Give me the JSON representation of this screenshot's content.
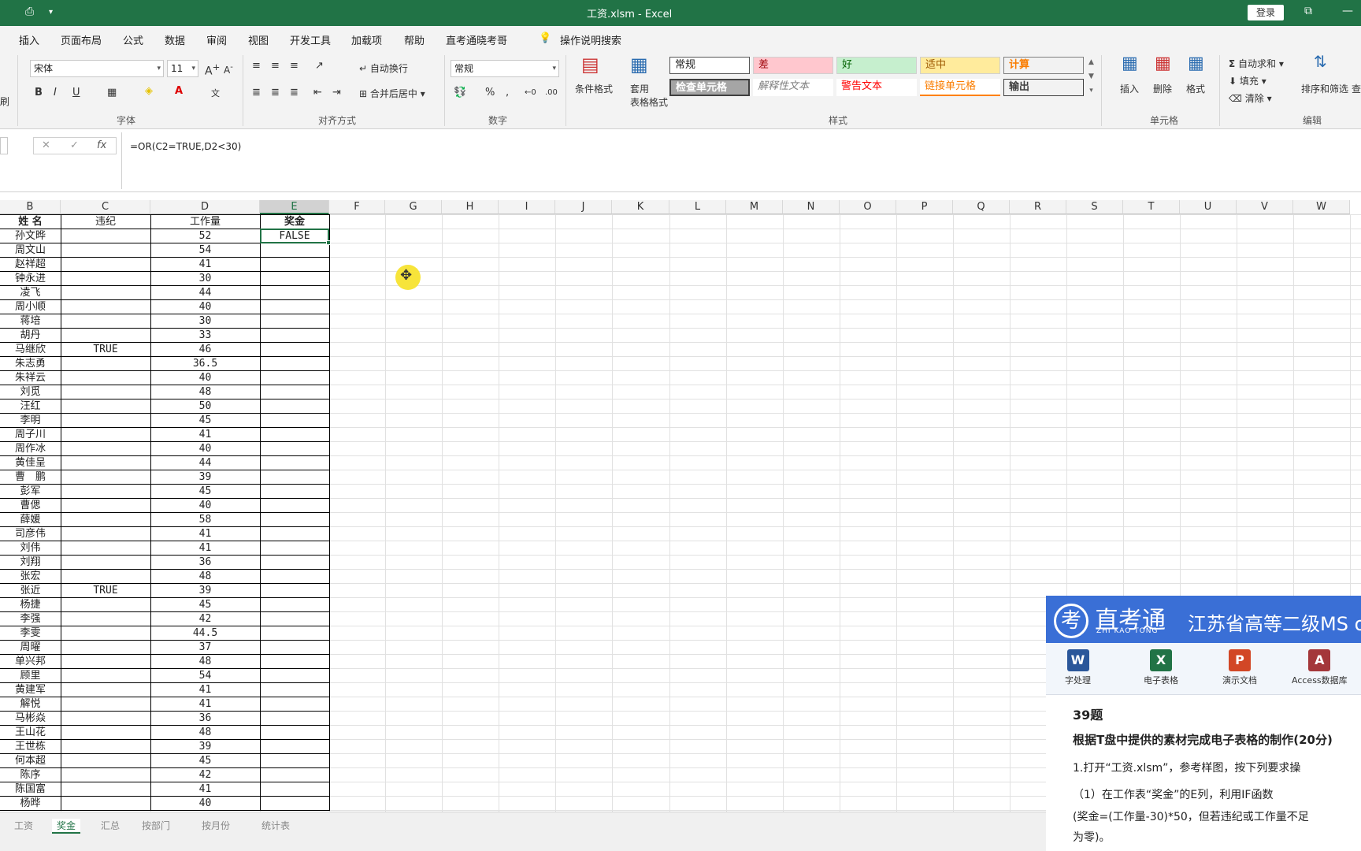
{
  "titlebar": {
    "doc_title": "工资.xlsm  -  Excel",
    "login": "登录",
    "qat_icon": "⎙",
    "qat_more": "▾",
    "restore_icon": "⧉",
    "minimize_icon": "—"
  },
  "menu": [
    "插入",
    "页面布局",
    "公式",
    "数据",
    "审阅",
    "视图",
    "开发工具",
    "加载项",
    "帮助",
    "直考通晓考哥",
    "操作说明搜索"
  ],
  "ribbon": {
    "clipboard_label": "刷",
    "font": {
      "name": "宋体",
      "size": "11",
      "label": "字体"
    },
    "align": {
      "wrap": "自动换行",
      "merge": "合并后居中",
      "label": "对齐方式"
    },
    "number": {
      "format": "常规",
      "label": "数字"
    },
    "styles": {
      "cond_format": "条件格式",
      "table_format_1": "套用",
      "table_format_2": "表格格式",
      "items": [
        "常规",
        "差",
        "好",
        "适中",
        "计算",
        "检查单元格",
        "解释性文本",
        "警告文本",
        "链接单元格",
        "输出"
      ],
      "label": "样式"
    },
    "cells": {
      "insert": "插入",
      "delete": "删除",
      "format": "格式",
      "label": "单元格"
    },
    "edit": {
      "autosum": "自动求和",
      "fill": "填充",
      "clear": "清除",
      "sort": "排序和筛选",
      "find": "查",
      "label": "编辑"
    }
  },
  "formula_bar": {
    "cancel": "✕",
    "enter": "✓",
    "fx": "fx",
    "formula": "=OR(C2=TRUE,D2<30)"
  },
  "columns": [
    "B",
    "C",
    "D",
    "E",
    "F",
    "G",
    "H",
    "I",
    "J",
    "K",
    "L",
    "M",
    "N",
    "O",
    "P",
    "Q",
    "R",
    "S",
    "T",
    "U",
    "V",
    "W"
  ],
  "table_header": [
    "姓 名",
    "违纪",
    "工作量",
    "奖金"
  ],
  "rows": [
    [
      "孙文晔",
      "",
      "52",
      "FALSE"
    ],
    [
      "周文山",
      "",
      "54",
      ""
    ],
    [
      "赵祥超",
      "",
      "41",
      ""
    ],
    [
      "钟永进",
      "",
      "30",
      ""
    ],
    [
      "凌飞",
      "",
      "44",
      ""
    ],
    [
      "周小顺",
      "",
      "40",
      ""
    ],
    [
      "蒋培",
      "",
      "30",
      ""
    ],
    [
      "胡丹",
      "",
      "33",
      ""
    ],
    [
      "马继欣",
      "TRUE",
      "46",
      ""
    ],
    [
      "朱志勇",
      "",
      "36.5",
      ""
    ],
    [
      "朱祥云",
      "",
      "40",
      ""
    ],
    [
      "刘觅",
      "",
      "48",
      ""
    ],
    [
      "汪红",
      "",
      "50",
      ""
    ],
    [
      "李明",
      "",
      "45",
      ""
    ],
    [
      "周子川",
      "",
      "41",
      ""
    ],
    [
      "周作冰",
      "",
      "40",
      ""
    ],
    [
      "黄佳呈",
      "",
      "44",
      ""
    ],
    [
      "曹　鹏",
      "",
      "39",
      ""
    ],
    [
      "彭军",
      "",
      "45",
      ""
    ],
    [
      "曹偲",
      "",
      "40",
      ""
    ],
    [
      "薛媛",
      "",
      "58",
      ""
    ],
    [
      "司彦伟",
      "",
      "41",
      ""
    ],
    [
      "刘伟",
      "",
      "41",
      ""
    ],
    [
      "刘翔",
      "",
      "36",
      ""
    ],
    [
      "张宏",
      "",
      "48",
      ""
    ],
    [
      "张近",
      "TRUE",
      "39",
      ""
    ],
    [
      "杨捷",
      "",
      "45",
      ""
    ],
    [
      "李强",
      "",
      "42",
      ""
    ],
    [
      "李雯",
      "",
      "44.5",
      ""
    ],
    [
      "周曜",
      "",
      "37",
      ""
    ],
    [
      "单兴邦",
      "",
      "48",
      ""
    ],
    [
      "顾里",
      "",
      "54",
      ""
    ],
    [
      "黄建军",
      "",
      "41",
      ""
    ],
    [
      "解悦",
      "",
      "41",
      ""
    ],
    [
      "马彬焱",
      "",
      "36",
      ""
    ],
    [
      "王山花",
      "",
      "48",
      ""
    ],
    [
      "王世栋",
      "",
      "39",
      ""
    ],
    [
      "何本超",
      "",
      "45",
      ""
    ],
    [
      "陈序",
      "",
      "42",
      ""
    ],
    [
      "陈国富",
      "",
      "41",
      ""
    ],
    [
      "杨晔",
      "",
      "40",
      ""
    ]
  ],
  "cursor_icon": "✥",
  "sheet_tabs": [
    "工资",
    "奖金",
    "汇总",
    "按部门",
    "按月份",
    "统计表"
  ],
  "overlay": {
    "logo": "考",
    "brand": "直考通",
    "brand_en": "ZHI KAO TONG",
    "province": "江苏省高等二级MS o",
    "apps": [
      {
        "icon": "W",
        "label": "字处理",
        "color": "#2b579a"
      },
      {
        "icon": "X",
        "label": "电子表格",
        "color": "#217346"
      },
      {
        "icon": "P",
        "label": "演示文档",
        "color": "#d24726"
      },
      {
        "icon": "A",
        "label": "Access数据库",
        "color": "#a4373a"
      }
    ],
    "question_no": "39题",
    "question_title": "根据T盘中提供的素材完成电子表格的制作(20分)",
    "q1": "1.打开“工资.xlsm”，参考样图，按下列要求操",
    "q2": "（1）在工作表“奖金”的E列，利用IF函数",
    "q3": "(奖金=(工作量-30)*50，但若违纪或工作量不足",
    "q4": "为零)。"
  }
}
